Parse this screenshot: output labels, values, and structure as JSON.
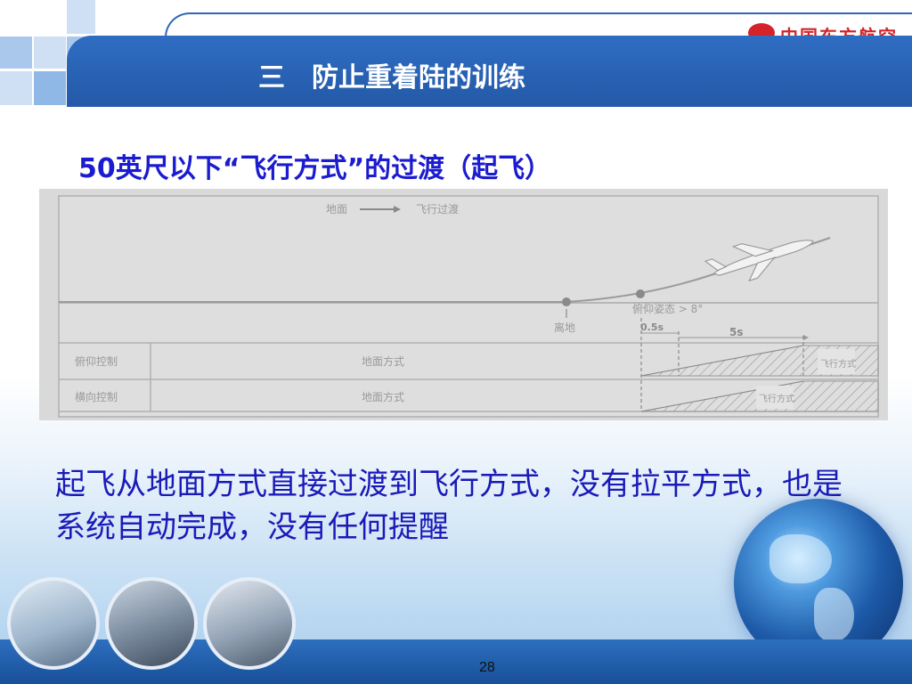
{
  "header": {
    "title": "三　防止重着陆的训练",
    "logo_text": "中国东方航空"
  },
  "subtitle": "50英尺以下“飞行方式”的过渡（起飞）",
  "diagram": {
    "top_label_left": "地面",
    "top_label_right": "飞行过渡",
    "liftoff_label": "离地",
    "pitch_label": "俯仰姿态 > 8°",
    "time_short": "0.5s",
    "time_long": "5s",
    "rows": [
      {
        "label": "俯仰控制",
        "mode": "地面方式",
        "flight_mode": "飞行方式"
      },
      {
        "label": "横向控制",
        "mode": "地面方式",
        "flight_mode": "飞行方式"
      }
    ]
  },
  "body_text": "起飞从地面方式直接过渡到飞行方式，没有拉平方式，也是系统自动完成，没有任何提醒",
  "footer": {
    "page_number": "28"
  },
  "colors": {
    "header_blue": "#2459a8",
    "subtitle_blue": "#1b1bd0",
    "body_blue": "#1a1ab8",
    "logo_red": "#d4242a"
  }
}
